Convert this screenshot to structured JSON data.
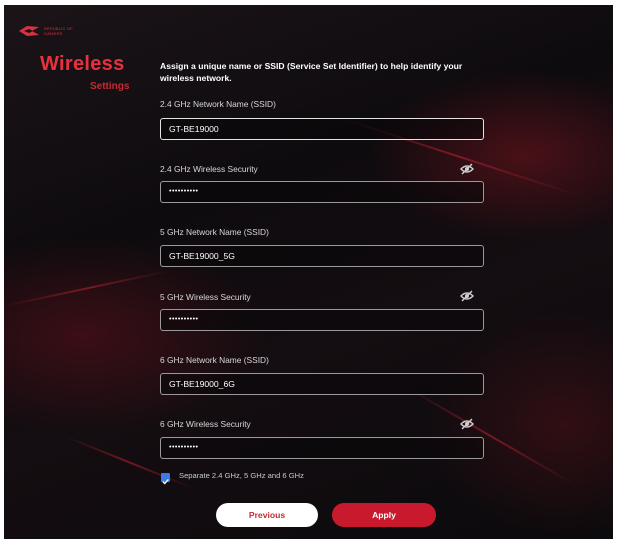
{
  "header": {
    "logo_text": "REPUBLIC OF GAMERS",
    "title": "Wireless",
    "subtitle": "Settings",
    "intro": "Assign a unique name or SSID (Service Set Identifier) to help identify your wireless network."
  },
  "fields": {
    "ssid_24": {
      "label": "2.4 GHz Network Name (SSID)",
      "value": "GT-BE19000"
    },
    "security_24": {
      "label": "2.4 GHz Wireless Security",
      "value": "••••••••••"
    },
    "ssid_5": {
      "label": "5 GHz Network Name (SSID)",
      "value": "GT-BE19000_5G"
    },
    "security_5": {
      "label": "5 GHz Wireless Security",
      "value": "••••••••••"
    },
    "ssid_6": {
      "label": "6 GHz Network Name (SSID)",
      "value": "GT-BE19000_6G"
    },
    "security_6": {
      "label": "6 GHz Wireless Security",
      "value": "••••••••••"
    }
  },
  "separate": {
    "label": "Separate 2.4 GHz, 5 GHz and 6 GHz",
    "checked": true
  },
  "buttons": {
    "previous": "Previous",
    "apply": "Apply"
  },
  "icons": {
    "password_toggle": "eye-slash-icon",
    "logo": "rog-eye-logo-icon"
  },
  "colors": {
    "accent": "#e8303e",
    "apply_bg": "#c9192c",
    "checkbox": "#3a7be8"
  }
}
